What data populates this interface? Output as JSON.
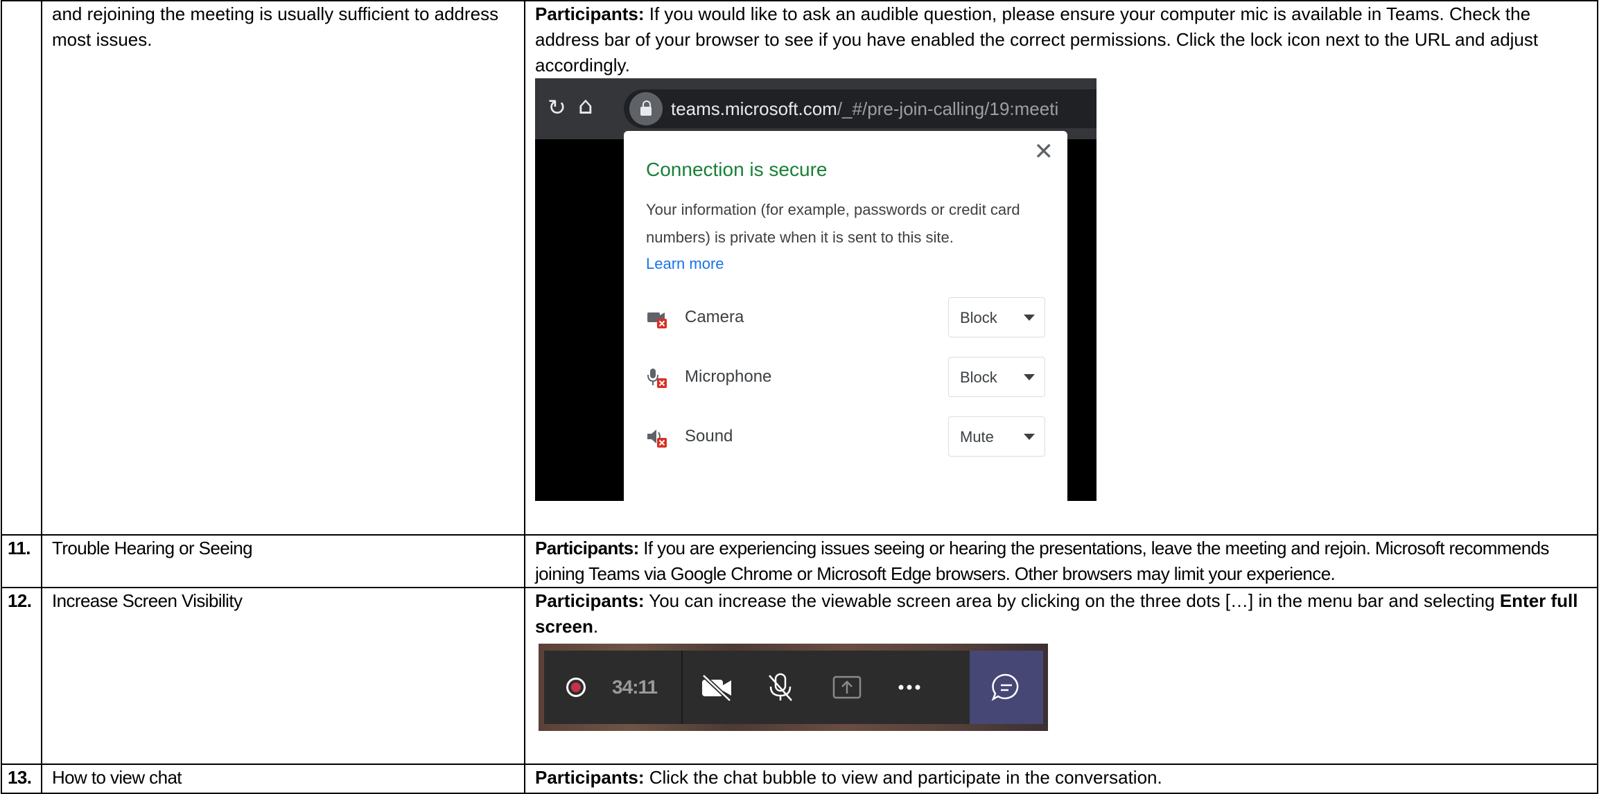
{
  "rows": {
    "r10": {
      "topic": "and rejoining the meeting is usually sufficient to address most issues.",
      "bold_label": "Participants:",
      "text": " If you would like to ask an audible question, please ensure your computer mic is available in Teams. Check the address bar of your browser to see if you have enabled the correct permissions. Click the lock icon next to the URL and adjust accordingly."
    },
    "r11": {
      "num": "11.",
      "topic": "Trouble Hearing or Seeing",
      "bold_label": "Participants:",
      "text": " If you are experiencing issues seeing or hearing the presentations, leave the meeting and rejoin. Microsoft recommends joining Teams via Google Chrome or Microsoft Edge browsers. Other browsers may limit your experience."
    },
    "r12": {
      "num": "12.",
      "topic": "Increase Screen Visibility",
      "bold_label": "Participants:",
      "text": " You can increase the viewable screen area by clicking on the three dots […] in the menu bar and selecting ",
      "bold_end": "Enter full screen",
      "period": "."
    },
    "r13": {
      "num": "13.",
      "topic": "How to view chat",
      "bold_label": "Participants:",
      "text": " Click the chat bubble to view and participate in the conversation."
    }
  },
  "browser_shot": {
    "reload_glyph": "↻",
    "home_glyph": "⌂",
    "url_host": "teams.microsoft.com",
    "url_path": "/_#/pre-join-calling/19:meeti",
    "close_glyph": "✕",
    "title": "Connection is secure",
    "info": "Your information (for example, passwords or credit card numbers) is private when it is sent to this site.",
    "learn_more": "Learn more",
    "permissions": [
      {
        "label": "Camera",
        "value": "Block",
        "icon": "camera-blocked-icon"
      },
      {
        "label": "Microphone",
        "value": "Block",
        "icon": "microphone-blocked-icon"
      },
      {
        "label": "Sound",
        "value": "Mute",
        "icon": "sound-muted-icon"
      }
    ],
    "colors": {
      "secure_green": "#188038",
      "link_blue": "#1a73e8",
      "blocked_red": "#d93025"
    }
  },
  "teams_toolbar": {
    "timer": "34:11",
    "icons": [
      "record-icon",
      "camera-off-icon",
      "mic-off-icon",
      "share-screen-icon",
      "more-options-icon",
      "chat-bubble-icon"
    ],
    "colors": {
      "record_red": "#c4314b",
      "chat_highlight": "#464775"
    }
  }
}
